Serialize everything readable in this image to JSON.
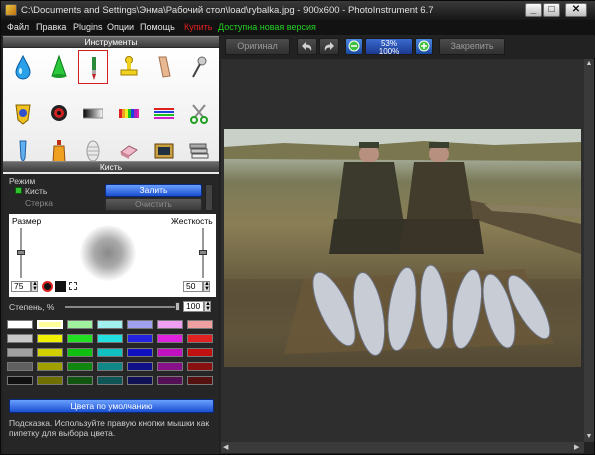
{
  "window": {
    "title": "C:\\Documents and Settings\\Энма\\Рабочий стол\\load\\rybalka.jpg - 900x600 - PhotoInstrument 6.7",
    "minimize_glyph": "_",
    "maximize_glyph": "□",
    "close_glyph": "✕"
  },
  "menu": {
    "items": [
      "Файл",
      "Правка",
      "Plugins",
      "Опции",
      "Помощь"
    ],
    "buy_label": "Купить",
    "update_label": "Доступна новая версия",
    "buy_color": "#e02020",
    "update_color": "#22d022"
  },
  "tools_panel": {
    "header": "Инструменты",
    "tools": [
      {
        "icon": "water-drop-icon"
      },
      {
        "icon": "cone-icon"
      },
      {
        "icon": "brush-icon",
        "selected": true
      },
      {
        "icon": "stamp-icon"
      },
      {
        "icon": "smudge-finger-icon"
      },
      {
        "icon": "pin-icon"
      },
      {
        "icon": "badge-icon"
      },
      {
        "icon": "red-eye-icon"
      },
      {
        "icon": "gradient-icon"
      },
      {
        "icon": "color-bars-icon"
      },
      {
        "icon": "lines-icon"
      },
      {
        "icon": "scissors-icon"
      },
      {
        "icon": "brush-tube-icon"
      },
      {
        "icon": "bottle-icon"
      },
      {
        "icon": "mummy-icon"
      },
      {
        "icon": "eraser-icon"
      },
      {
        "icon": "photo-frame-icon"
      },
      {
        "icon": "text-layers-icon"
      }
    ]
  },
  "brush_panel": {
    "header": "Кисть",
    "mode_label": "Режим",
    "brush_option": "Кисть",
    "erase_option": "Стерка",
    "fill_button": "Залить",
    "clear_button": "Очистить",
    "size_label": "Размер",
    "hardness_label": "Жесткость",
    "size_value": "75",
    "hardness_value": "50",
    "degree_label": "Степень, %",
    "degree_value": "100",
    "default_colors_button": "Цвета по умолчанию",
    "hint": "Подсказка. Используйте правую кнопки мышки как пипетку для выбора цвета."
  },
  "palette": {
    "rows": [
      [
        "#ffffff",
        "#ffff99",
        "#a0f0a0",
        "#a0f0f0",
        "#a0a0f0",
        "#f0a0f0",
        "#f0a0a0"
      ],
      [
        "#c8c8c8",
        "#f0f000",
        "#22e022",
        "#22e0e0",
        "#2222e0",
        "#e022e0",
        "#e02222"
      ],
      [
        "#a0a0a0",
        "#d0d000",
        "#10c010",
        "#10c0c0",
        "#1010c0",
        "#c010c0",
        "#c01010"
      ],
      [
        "#606060",
        "#a0a000",
        "#108810",
        "#108888",
        "#101088",
        "#881088",
        "#881010"
      ],
      [
        "#101010",
        "#707000",
        "#105510",
        "#105555",
        "#101055",
        "#551055",
        "#551010"
      ]
    ],
    "selected": "#ffff99"
  },
  "toolbar": {
    "original_label": "Оригинал",
    "zoom_label": "53%\n100%",
    "fix_label": "Закрепить",
    "undo_icon": "undo-icon",
    "redo_icon": "redo-icon",
    "zoom_out_icon": "zoom-out-icon",
    "zoom_in_icon": "zoom-in-icon"
  }
}
